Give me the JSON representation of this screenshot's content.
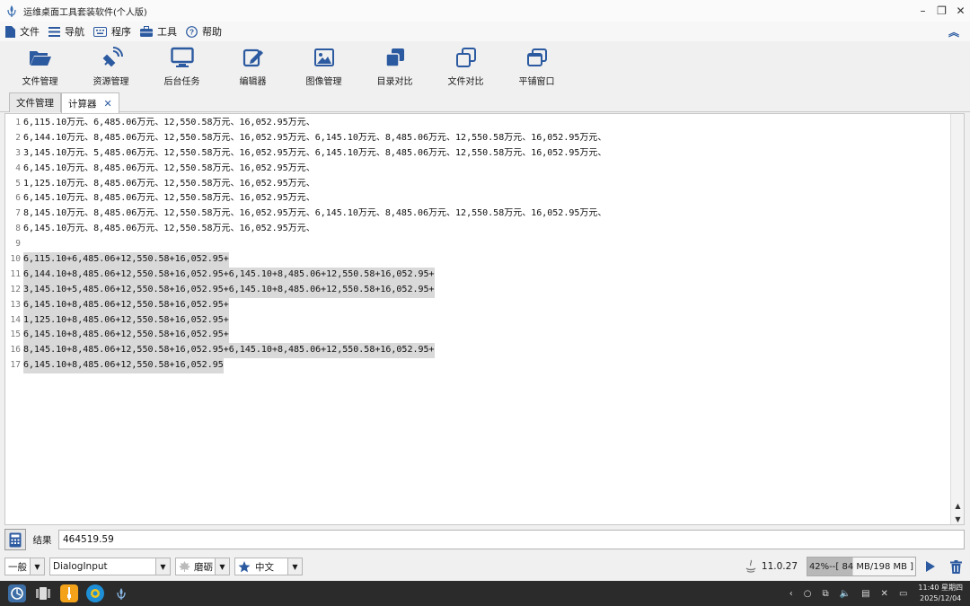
{
  "window": {
    "title": "运维桌面工具套装软件(个人版)"
  },
  "menu": [
    {
      "label": "文件",
      "icon": "file-icon"
    },
    {
      "label": "导航",
      "icon": "list-icon"
    },
    {
      "label": "程序",
      "icon": "keyboard-icon"
    },
    {
      "label": "工具",
      "icon": "toolbox-icon"
    },
    {
      "label": "帮助",
      "icon": "help-icon"
    }
  ],
  "toolbar": [
    {
      "label": "文件管理",
      "icon": "folder-open-icon"
    },
    {
      "label": "资源管理",
      "icon": "satellite-icon"
    },
    {
      "label": "后台任务",
      "icon": "monitor-icon"
    },
    {
      "label": "编辑器",
      "icon": "edit-icon"
    },
    {
      "label": "图像管理",
      "icon": "image-icon"
    },
    {
      "label": "目录对比",
      "icon": "layers-icon"
    },
    {
      "label": "文件对比",
      "icon": "copy-icon"
    },
    {
      "label": "平铺窗口",
      "icon": "window-restore-icon"
    }
  ],
  "tabs": [
    {
      "label": "文件管理",
      "active": false
    },
    {
      "label": "计算器",
      "active": true,
      "close": "✕"
    }
  ],
  "editor": {
    "lines": [
      {
        "n": "1",
        "text": "6,115.10万元、6,485.06万元、12,550.58万元、16,052.95万元、",
        "selected": false
      },
      {
        "n": "2",
        "text": "6,144.10万元、8,485.06万元、12,550.58万元、16,052.95万元、6,145.10万元、8,485.06万元、12,550.58万元、16,052.95万元、",
        "selected": false
      },
      {
        "n": "3",
        "text": "3,145.10万元、5,485.06万元、12,550.58万元、16,052.95万元、6,145.10万元、8,485.06万元、12,550.58万元、16,052.95万元、",
        "selected": false
      },
      {
        "n": "4",
        "text": "6,145.10万元、8,485.06万元、12,550.58万元、16,052.95万元、",
        "selected": false
      },
      {
        "n": "5",
        "text": "1,125.10万元、8,485.06万元、12,550.58万元、16,052.95万元、",
        "selected": false
      },
      {
        "n": "6",
        "text": "6,145.10万元、8,485.06万元、12,550.58万元、16,052.95万元、",
        "selected": false
      },
      {
        "n": "7",
        "text": "8,145.10万元、8,485.06万元、12,550.58万元、16,052.95万元、6,145.10万元、8,485.06万元、12,550.58万元、16,052.95万元、",
        "selected": false
      },
      {
        "n": "8",
        "text": "6,145.10万元、8,485.06万元、12,550.58万元、16,052.95万元、",
        "selected": false
      },
      {
        "n": "9",
        "text": "",
        "selected": false
      },
      {
        "n": "10",
        "text": "6,115.10+6,485.06+12,550.58+16,052.95+",
        "selected": true
      },
      {
        "n": "11",
        "text": "6,144.10+8,485.06+12,550.58+16,052.95+6,145.10+8,485.06+12,550.58+16,052.95+",
        "selected": true
      },
      {
        "n": "12",
        "text": "3,145.10+5,485.06+12,550.58+16,052.95+6,145.10+8,485.06+12,550.58+16,052.95+",
        "selected": true
      },
      {
        "n": "13",
        "text": "6,145.10+8,485.06+12,550.58+16,052.95+",
        "selected": true
      },
      {
        "n": "14",
        "text": "1,125.10+8,485.06+12,550.58+16,052.95+",
        "selected": true
      },
      {
        "n": "15",
        "text": "6,145.10+8,485.06+12,550.58+16,052.95+",
        "selected": true
      },
      {
        "n": "16",
        "text": "8,145.10+8,485.06+12,550.58+16,052.95+6,145.10+8,485.06+12,550.58+16,052.95+",
        "selected": true
      },
      {
        "n": "17",
        "text": "6,145.10+8,485.06+12,550.58+16,052.95",
        "selected": true
      }
    ]
  },
  "result": {
    "label": "结果",
    "value": "464519.59"
  },
  "status": {
    "mode": "一般",
    "font": "DialogInput",
    "theme": "磨砺",
    "lang": "中文",
    "java_version": "11.0.27",
    "memory_text": "42%--[ 84 MB/198 MB ]",
    "memory_fraction": 0.42
  },
  "taskbar": {
    "time": "11:40 星期四",
    "date": "2025/12/04"
  },
  "colors": {
    "accent": "#2c5aa0",
    "selection": "#d9d9d9",
    "taskbar": "#2b2b2b"
  }
}
